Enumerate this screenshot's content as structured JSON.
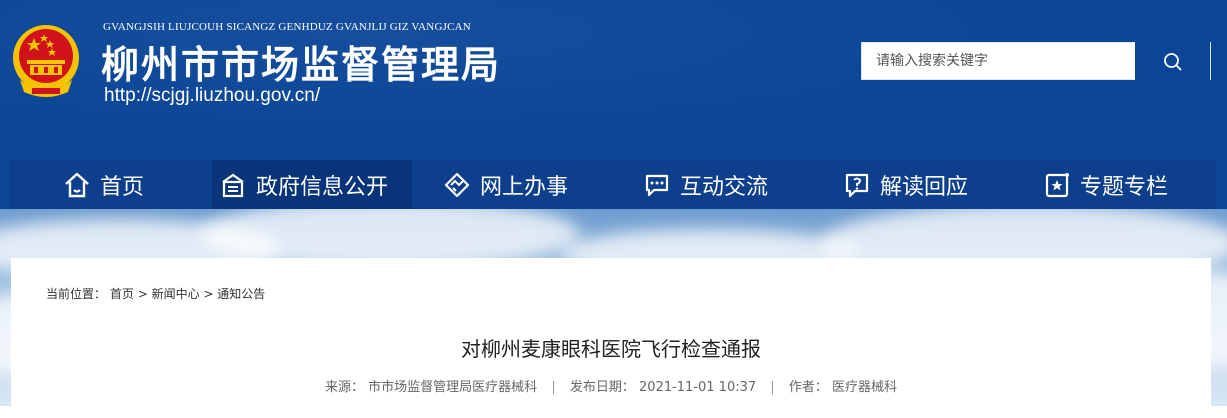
{
  "header": {
    "pinyin": "GVANGJSIH LIUJCOUH SICANGZ GENHDUZ GVANJLIJ GIZ VANGJCAN",
    "title": "柳州市市场监督管理局",
    "url": "http://scjgj.liuzhou.gov.cn/",
    "emblem_icon": "national-emblem-icon"
  },
  "search": {
    "placeholder": "请输入搜索关键字",
    "value": "",
    "button_icon": "search-icon"
  },
  "nav": {
    "items": [
      {
        "label": "首页",
        "icon": "home-icon"
      },
      {
        "label": "政府信息公开",
        "icon": "info-disclosure-icon"
      },
      {
        "label": "网上办事",
        "icon": "handshake-icon"
      },
      {
        "label": "互动交流",
        "icon": "chat-icon"
      },
      {
        "label": "解读回应",
        "icon": "question-chat-icon"
      },
      {
        "label": "专题专栏",
        "icon": "star-note-icon"
      }
    ]
  },
  "breadcrumb": {
    "prefix": "当前位置：",
    "items": [
      "首页",
      "新闻中心",
      "通知公告"
    ],
    "separator": " > "
  },
  "article": {
    "title": "对柳州麦康眼科医院飞行检查通报",
    "source_label": "来源：",
    "source": "市市场监督管理局医疗器械科",
    "date_label": "发布日期：",
    "date": "2021-11-01 10:37",
    "author_label": "作者：",
    "author": "医疗器械科"
  },
  "colors": {
    "primary": "#0a4597",
    "nav_bg": "#0d3f8c",
    "emblem_red": "#d0121b",
    "emblem_gold": "#f5c400"
  }
}
